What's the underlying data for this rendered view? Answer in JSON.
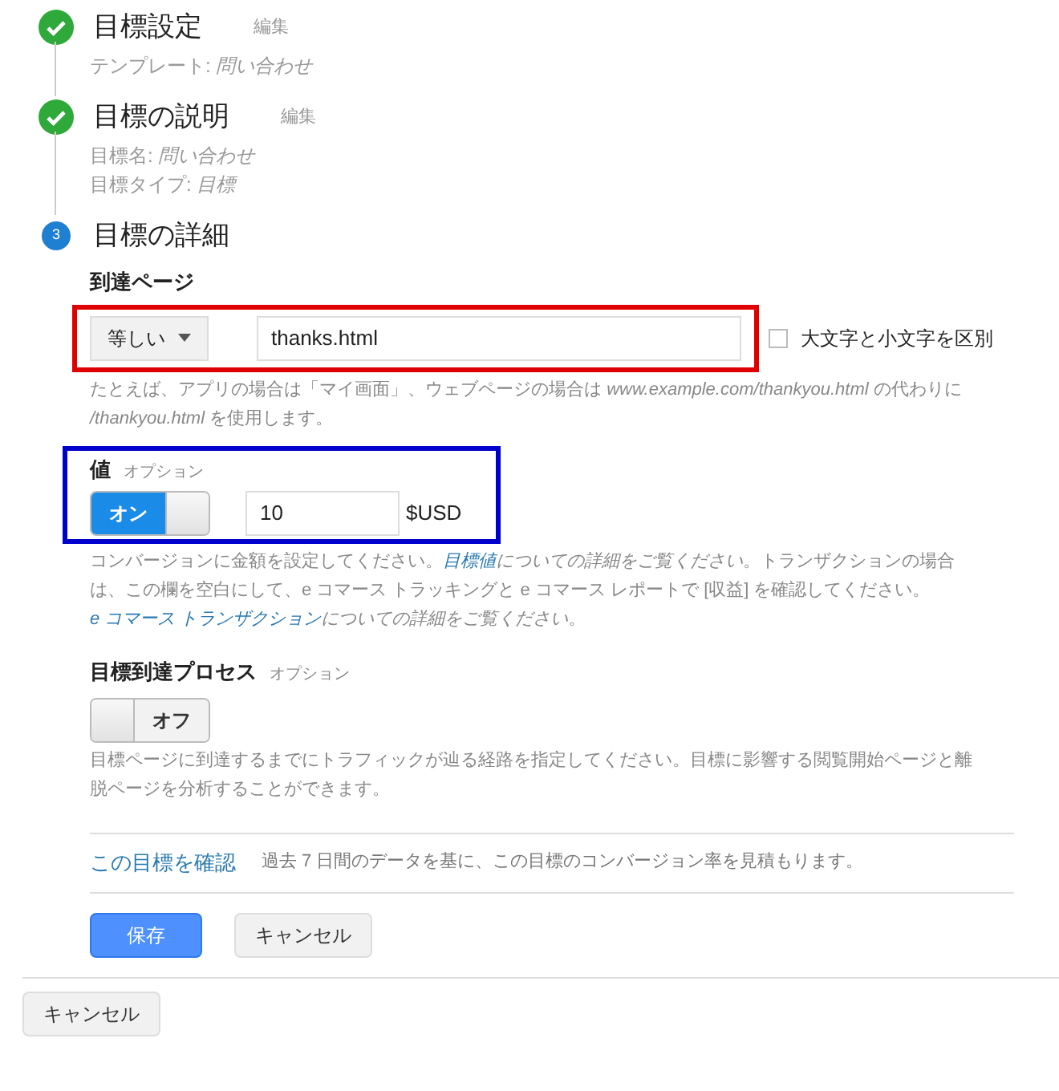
{
  "steps": [
    {
      "kind": "done",
      "title": "目標設定",
      "edit": "編集",
      "details": [
        {
          "label": "テンプレート: ",
          "value": "問い合わせ"
        }
      ]
    },
    {
      "kind": "done",
      "title": "目標の説明",
      "edit": "編集",
      "details": [
        {
          "label": "目標名: ",
          "value": "問い合わせ"
        },
        {
          "label": "目標タイプ: ",
          "value": "目標"
        }
      ]
    },
    {
      "kind": "current",
      "number": "3",
      "title": "目標の詳細"
    }
  ],
  "destination": {
    "label": "到達ページ",
    "match": "等しい",
    "value": "thanks.html",
    "case_label": "大文字と小文字を区別",
    "case_checked": false,
    "help": [
      {
        "kind": "text",
        "text": "たとえば、アプリの場合は「マイ画面」、ウェブページの場合は "
      },
      {
        "kind": "italic",
        "text": "www.example.com/thankyou.html"
      },
      {
        "kind": "text",
        "text": " の代わりに "
      },
      {
        "kind": "italic",
        "text": "/thankyou.html"
      },
      {
        "kind": "text",
        "text": " を使用します。"
      }
    ]
  },
  "value": {
    "label": "値",
    "optional": "オプション",
    "toggle": {
      "on": true,
      "label": "オン"
    },
    "amount": "10",
    "currency": "$USD",
    "help": [
      {
        "kind": "text",
        "text": "コンバージョンに金額を設定してください。"
      },
      {
        "kind": "link",
        "text": "目標値"
      },
      {
        "kind": "italic",
        "text": "についての詳細をご覧ください"
      },
      {
        "kind": "text",
        "text": "。トランザクションの場合は、この欄を空白にして、e コマース トラッキングと e コマース レポートで [収益] を確認してください。"
      },
      {
        "kind": "link",
        "text": "e コマース トランザクション"
      },
      {
        "kind": "italic",
        "text": "についての詳細をご覧ください"
      },
      {
        "kind": "text",
        "text": "。"
      }
    ]
  },
  "funnel": {
    "label": "目標到達プロセス",
    "optional": "オプション",
    "toggle": {
      "on": false,
      "label": "オフ"
    },
    "help": [
      {
        "kind": "text",
        "text": "目標ページに到達するまでにトラフィックが辿る経路を指定してください。目標に影響する閲覧開始ページと離脱ページを分析することができます。"
      }
    ]
  },
  "verify": {
    "link": "この目標を確認",
    "text": "過去 7 日間のデータを基に、この目標のコンバージョン率を見積もります。"
  },
  "buttons": [
    {
      "kind": "primary",
      "label": "保存"
    },
    {
      "kind": "secondary",
      "label": "キャンセル"
    }
  ],
  "footer_button": "キャンセル",
  "annotations": [
    {
      "color": "#e00000"
    },
    {
      "color": "#0000cc"
    }
  ]
}
